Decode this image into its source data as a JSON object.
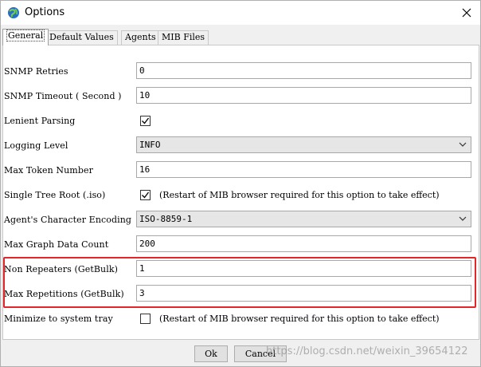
{
  "window": {
    "title": "Options"
  },
  "tabs": [
    {
      "label": "General",
      "active": true
    },
    {
      "label": "Default Values",
      "active": false
    },
    {
      "label": "Agents",
      "active": false
    },
    {
      "label": "MIB Files",
      "active": false
    }
  ],
  "general": {
    "snmp_retries": {
      "label": "SNMP Retries",
      "value": "0"
    },
    "snmp_timeout": {
      "label": "SNMP Timeout ( Second )",
      "value": "10"
    },
    "lenient_parsing": {
      "label": "Lenient Parsing",
      "checked": true
    },
    "logging_level": {
      "label": "Logging Level",
      "value": "INFO"
    },
    "max_token_number": {
      "label": "Max Token Number",
      "value": "16"
    },
    "single_tree_root": {
      "label": "Single Tree Root (.iso)",
      "checked": true,
      "note": "(Restart of MIB browser required for this option to take effect)"
    },
    "agent_encoding": {
      "label": "Agent's Character Encoding",
      "value": "ISO-8859-1"
    },
    "max_graph_data_count": {
      "label": "Max Graph Data Count",
      "value": "200"
    },
    "non_repeaters": {
      "label": "Non Repeaters (GetBulk)",
      "value": "1"
    },
    "max_repetitions": {
      "label": "Max Repetitions (GetBulk)",
      "value": "3"
    },
    "minimize_to_tray": {
      "label": "Minimize to system tray",
      "checked": false,
      "note": "(Restart of MIB browser required for this option to take effect)"
    }
  },
  "buttons": {
    "ok": "Ok",
    "cancel": "Cancel"
  },
  "watermark": "https://blog.csdn.net/weixin_39654122",
  "colors": {
    "highlight": "#e0272a",
    "panel_bg": "#ffffff",
    "window_bg": "#f0f0f0"
  }
}
